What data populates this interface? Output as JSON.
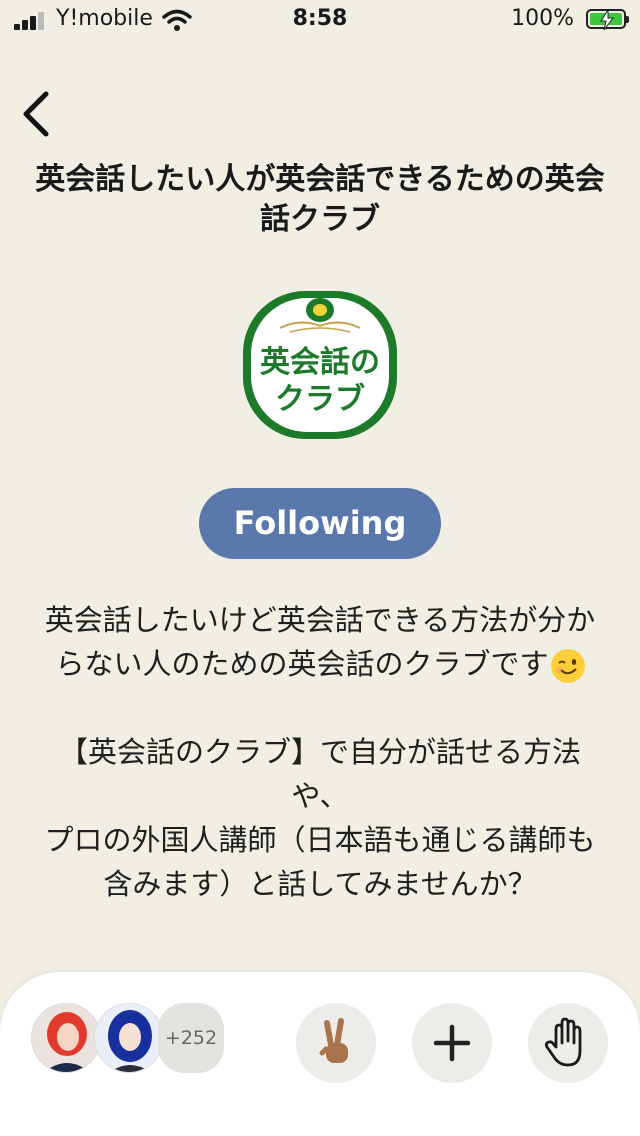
{
  "status_bar": {
    "carrier": "Y!mobile",
    "time": "8:58",
    "battery_percent": "100%"
  },
  "room": {
    "title": "英会話したい人が英会話できるための英会話クラブ",
    "logo_text_line1": "英会話の",
    "logo_text_line2": "クラブ",
    "follow_label": "Following",
    "description_1": "英会話したいけど英会話できる方法が分からない人のための英会話のクラブです",
    "description_2": "【英会話のクラブ】で自分が話せる方法や、",
    "description_3": "プロの外国人講師（日本語も通じる講師も含みます）と話してみませんか？"
  },
  "bottom_bar": {
    "listener_count": "+252"
  },
  "colors": {
    "background": "#f1efe4",
    "follow_button": "#5a78ac",
    "logo_green": "#1d7a2a",
    "battery_green": "#3ec73e"
  },
  "icons": [
    "signal-icon",
    "wifi-icon",
    "battery-icon",
    "back-icon",
    "peace-sign-icon",
    "plus-icon",
    "raised-hand-icon"
  ]
}
